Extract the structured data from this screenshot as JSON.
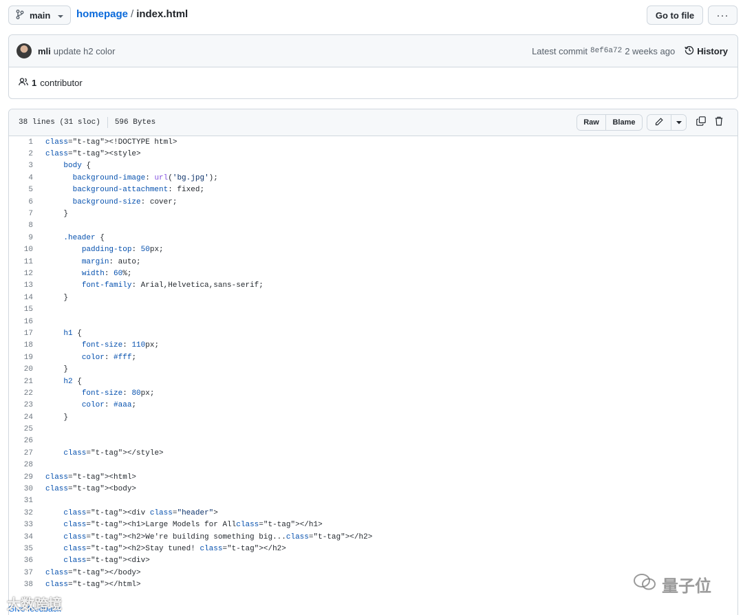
{
  "topbar": {
    "branch": "main",
    "repo": "homepage",
    "separator": "/",
    "file": "index.html",
    "goto_label": "Go to file",
    "more_label": "···"
  },
  "commit": {
    "author": "mli",
    "message": "update h2 color",
    "latest_label": "Latest commit",
    "sha": "8ef6a72",
    "when": "2 weeks ago",
    "history_label": "History",
    "contributors_count": "1",
    "contributors_label": "contributor"
  },
  "file": {
    "lines_info": "38 lines (31 sloc)",
    "size": "596 Bytes",
    "raw_label": "Raw",
    "blame_label": "Blame"
  },
  "code_lines": [
    {
      "n": "1",
      "text": "<!DOCTYPE html>"
    },
    {
      "n": "2",
      "text": "<style>"
    },
    {
      "n": "3",
      "text": "    body {"
    },
    {
      "n": "4",
      "text": "      background-image: url('bg.jpg');"
    },
    {
      "n": "5",
      "text": "      background-attachment: fixed;"
    },
    {
      "n": "6",
      "text": "      background-size: cover;"
    },
    {
      "n": "7",
      "text": "    }"
    },
    {
      "n": "8",
      "text": ""
    },
    {
      "n": "9",
      "text": "    .header {"
    },
    {
      "n": "10",
      "text": "        padding-top: 50px;"
    },
    {
      "n": "11",
      "text": "        margin: auto;"
    },
    {
      "n": "12",
      "text": "        width: 60%;"
    },
    {
      "n": "13",
      "text": "        font-family: Arial,Helvetica,sans-serif;"
    },
    {
      "n": "14",
      "text": "    }"
    },
    {
      "n": "15",
      "text": ""
    },
    {
      "n": "16",
      "text": ""
    },
    {
      "n": "17",
      "text": "    h1 {"
    },
    {
      "n": "18",
      "text": "        font-size: 110px;"
    },
    {
      "n": "19",
      "text": "        color: #fff;"
    },
    {
      "n": "20",
      "text": "    }"
    },
    {
      "n": "21",
      "text": "    h2 {"
    },
    {
      "n": "22",
      "text": "        font-size: 80px;"
    },
    {
      "n": "23",
      "text": "        color: #aaa;"
    },
    {
      "n": "24",
      "text": "    }"
    },
    {
      "n": "25",
      "text": ""
    },
    {
      "n": "26",
      "text": ""
    },
    {
      "n": "27",
      "text": "    </style>"
    },
    {
      "n": "28",
      "text": ""
    },
    {
      "n": "29",
      "text": "<html>"
    },
    {
      "n": "30",
      "text": "<body>"
    },
    {
      "n": "31",
      "text": ""
    },
    {
      "n": "32",
      "text": "    <div class=\"header\">"
    },
    {
      "n": "33",
      "text": "    <h1>Large Models for All</h1>"
    },
    {
      "n": "34",
      "text": "    <h2>We're building something big...</h2>"
    },
    {
      "n": "35",
      "text": "    <h2>Stay tuned! </h2>"
    },
    {
      "n": "36",
      "text": "    <div>"
    },
    {
      "n": "37",
      "text": "</body>"
    },
    {
      "n": "38",
      "text": "</html>"
    }
  ],
  "footer": {
    "feedback": "Give feedback",
    "watermark_left": "大数跨境",
    "watermark_right": "量子位"
  },
  "icons": {
    "branch": "git-branch-icon",
    "caret": "triangle-down-icon",
    "history": "history-icon",
    "people": "people-icon",
    "pencil": "pencil-icon",
    "copy": "copy-icon",
    "trash": "trash-icon"
  }
}
